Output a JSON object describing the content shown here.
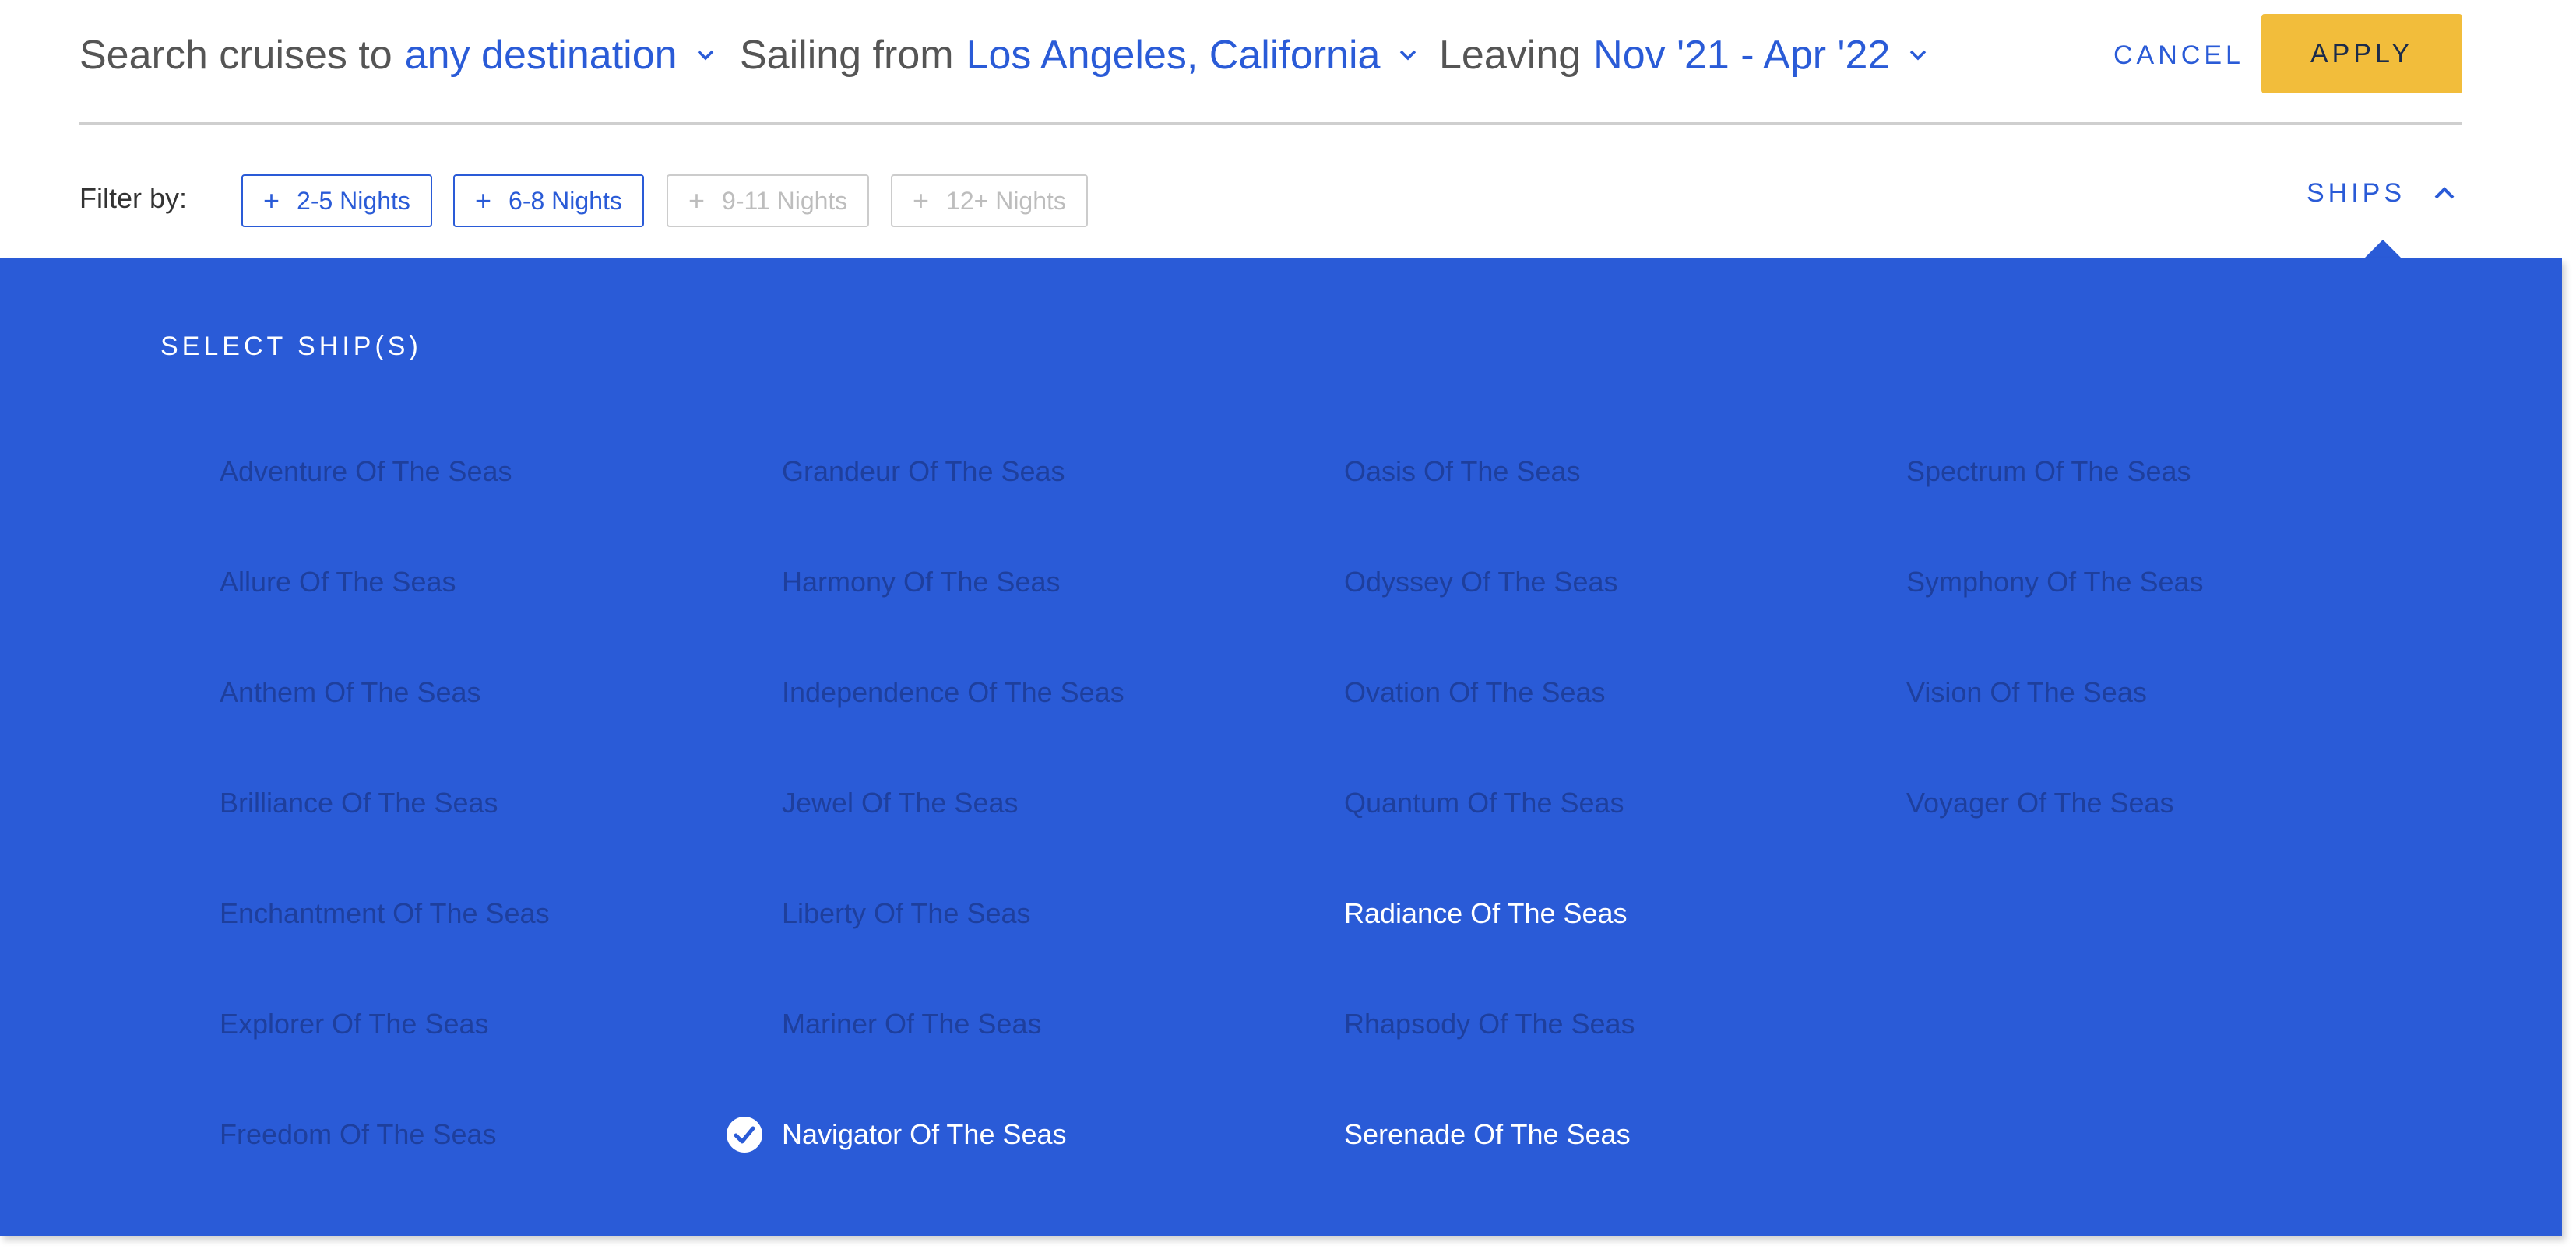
{
  "search": {
    "destination_label": "Search cruises to",
    "destination_value": "any destination",
    "departure_label": "Sailing from",
    "departure_value": "Los Angeles, California",
    "dates_label": "Leaving",
    "dates_value": "Nov '21 - Apr '22",
    "cancel_label": "CANCEL",
    "apply_label": "APPLY"
  },
  "filters": {
    "label": "Filter by:",
    "chips": [
      {
        "label": "2-5 Nights",
        "enabled": true
      },
      {
        "label": "6-8 Nights",
        "enabled": true
      },
      {
        "label": "9-11 Nights",
        "enabled": false
      },
      {
        "label": "12+ Nights",
        "enabled": false
      }
    ],
    "ships_toggle_label": "SHIPS"
  },
  "ships_panel": {
    "title": "SELECT SHIP(S)",
    "columns": [
      [
        {
          "name": "Adventure Of The Seas",
          "available": false,
          "selected": false
        },
        {
          "name": "Allure Of The Seas",
          "available": false,
          "selected": false
        },
        {
          "name": "Anthem Of The Seas",
          "available": false,
          "selected": false
        },
        {
          "name": "Brilliance Of The Seas",
          "available": false,
          "selected": false
        },
        {
          "name": "Enchantment Of The Seas",
          "available": false,
          "selected": false
        },
        {
          "name": "Explorer Of The Seas",
          "available": false,
          "selected": false
        },
        {
          "name": "Freedom Of The Seas",
          "available": false,
          "selected": false
        }
      ],
      [
        {
          "name": "Grandeur Of The Seas",
          "available": false,
          "selected": false
        },
        {
          "name": "Harmony Of The Seas",
          "available": false,
          "selected": false
        },
        {
          "name": "Independence Of The Seas",
          "available": false,
          "selected": false
        },
        {
          "name": "Jewel Of The Seas",
          "available": false,
          "selected": false
        },
        {
          "name": "Liberty Of The Seas",
          "available": false,
          "selected": false
        },
        {
          "name": "Mariner Of The Seas",
          "available": false,
          "selected": false
        },
        {
          "name": "Navigator Of The Seas",
          "available": true,
          "selected": true
        }
      ],
      [
        {
          "name": "Oasis Of The Seas",
          "available": false,
          "selected": false
        },
        {
          "name": "Odyssey Of The Seas",
          "available": false,
          "selected": false
        },
        {
          "name": "Ovation Of The Seas",
          "available": false,
          "selected": false
        },
        {
          "name": "Quantum Of The Seas",
          "available": false,
          "selected": false
        },
        {
          "name": "Radiance Of The Seas",
          "available": true,
          "selected": false
        },
        {
          "name": "Rhapsody Of The Seas",
          "available": false,
          "selected": false
        },
        {
          "name": "Serenade Of The Seas",
          "available": true,
          "selected": false
        }
      ],
      [
        {
          "name": "Spectrum Of The Seas",
          "available": false,
          "selected": false
        },
        {
          "name": "Symphony Of The Seas",
          "available": false,
          "selected": false
        },
        {
          "name": "Vision Of The Seas",
          "available": false,
          "selected": false
        },
        {
          "name": "Voyager Of The Seas",
          "available": false,
          "selected": false
        }
      ]
    ]
  },
  "icons": {
    "dropdown": "chevron-down-icon",
    "collapse": "chevron-up-icon",
    "add": "plus-icon",
    "selected": "check-circle-icon"
  },
  "colors": {
    "accent_blue": "#2a5bd7",
    "apply_yellow": "#f2bd3b",
    "unavailable_text": "#1e3a8a",
    "available_text": "#ffffff"
  }
}
